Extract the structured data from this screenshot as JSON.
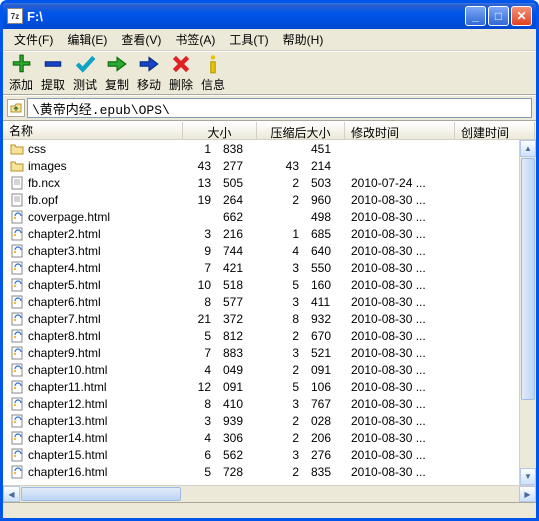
{
  "window": {
    "title": "F:\\"
  },
  "menu": {
    "file": "文件(F)",
    "edit": "编辑(E)",
    "view": "查看(V)",
    "bookmark": "书签(A)",
    "tools": "工具(T)",
    "help": "帮助(H)"
  },
  "toolbar": {
    "add": "添加",
    "extract": "提取",
    "test": "测试",
    "copy": "复制",
    "move": "移动",
    "delete": "删除",
    "info": "信息"
  },
  "path": {
    "value": "\\黄帝内经.epub\\OPS\\"
  },
  "columns": {
    "name": "名称",
    "size": "大小",
    "compressed": "压缩后大小",
    "mtime": "修改时间",
    "ctime": "创建时间"
  },
  "files": [
    {
      "icon": "folder",
      "name": "css",
      "size1": "1",
      "size2": "838",
      "comp1": "",
      "comp2": "451",
      "mtime": "",
      "ctime": ""
    },
    {
      "icon": "folder",
      "name": "images",
      "size1": "43",
      "size2": "277",
      "comp1": "43",
      "comp2": "214",
      "mtime": "",
      "ctime": ""
    },
    {
      "icon": "file",
      "name": "fb.ncx",
      "size1": "13",
      "size2": "505",
      "comp1": "2",
      "comp2": "503",
      "mtime": "2010-07-24 ...",
      "ctime": ""
    },
    {
      "icon": "file",
      "name": "fb.opf",
      "size1": "19",
      "size2": "264",
      "comp1": "2",
      "comp2": "960",
      "mtime": "2010-08-30 ...",
      "ctime": ""
    },
    {
      "icon": "html",
      "name": "coverpage.html",
      "size1": "",
      "size2": "662",
      "comp1": "",
      "comp2": "498",
      "mtime": "2010-08-30 ...",
      "ctime": ""
    },
    {
      "icon": "html",
      "name": "chapter2.html",
      "size1": "3",
      "size2": "216",
      "comp1": "1",
      "comp2": "685",
      "mtime": "2010-08-30 ...",
      "ctime": ""
    },
    {
      "icon": "html",
      "name": "chapter3.html",
      "size1": "9",
      "size2": "744",
      "comp1": "4",
      "comp2": "640",
      "mtime": "2010-08-30 ...",
      "ctime": ""
    },
    {
      "icon": "html",
      "name": "chapter4.html",
      "size1": "7",
      "size2": "421",
      "comp1": "3",
      "comp2": "550",
      "mtime": "2010-08-30 ...",
      "ctime": ""
    },
    {
      "icon": "html",
      "name": "chapter5.html",
      "size1": "10",
      "size2": "518",
      "comp1": "5",
      "comp2": "160",
      "mtime": "2010-08-30 ...",
      "ctime": ""
    },
    {
      "icon": "html",
      "name": "chapter6.html",
      "size1": "8",
      "size2": "577",
      "comp1": "3",
      "comp2": "411",
      "mtime": "2010-08-30 ...",
      "ctime": ""
    },
    {
      "icon": "html",
      "name": "chapter7.html",
      "size1": "21",
      "size2": "372",
      "comp1": "8",
      "comp2": "932",
      "mtime": "2010-08-30 ...",
      "ctime": ""
    },
    {
      "icon": "html",
      "name": "chapter8.html",
      "size1": "5",
      "size2": "812",
      "comp1": "2",
      "comp2": "670",
      "mtime": "2010-08-30 ...",
      "ctime": ""
    },
    {
      "icon": "html",
      "name": "chapter9.html",
      "size1": "7",
      "size2": "883",
      "comp1": "3",
      "comp2": "521",
      "mtime": "2010-08-30 ...",
      "ctime": ""
    },
    {
      "icon": "html",
      "name": "chapter10.html",
      "size1": "4",
      "size2": "049",
      "comp1": "2",
      "comp2": "091",
      "mtime": "2010-08-30 ...",
      "ctime": ""
    },
    {
      "icon": "html",
      "name": "chapter11.html",
      "size1": "12",
      "size2": "091",
      "comp1": "5",
      "comp2": "106",
      "mtime": "2010-08-30 ...",
      "ctime": ""
    },
    {
      "icon": "html",
      "name": "chapter12.html",
      "size1": "8",
      "size2": "410",
      "comp1": "3",
      "comp2": "767",
      "mtime": "2010-08-30 ...",
      "ctime": ""
    },
    {
      "icon": "html",
      "name": "chapter13.html",
      "size1": "3",
      "size2": "939",
      "comp1": "2",
      "comp2": "028",
      "mtime": "2010-08-30 ...",
      "ctime": ""
    },
    {
      "icon": "html",
      "name": "chapter14.html",
      "size1": "4",
      "size2": "306",
      "comp1": "2",
      "comp2": "206",
      "mtime": "2010-08-30 ...",
      "ctime": ""
    },
    {
      "icon": "html",
      "name": "chapter15.html",
      "size1": "6",
      "size2": "562",
      "comp1": "3",
      "comp2": "276",
      "mtime": "2010-08-30 ...",
      "ctime": ""
    },
    {
      "icon": "html",
      "name": "chapter16.html",
      "size1": "5",
      "size2": "728",
      "comp1": "2",
      "comp2": "835",
      "mtime": "2010-08-30 ...",
      "ctime": ""
    }
  ]
}
